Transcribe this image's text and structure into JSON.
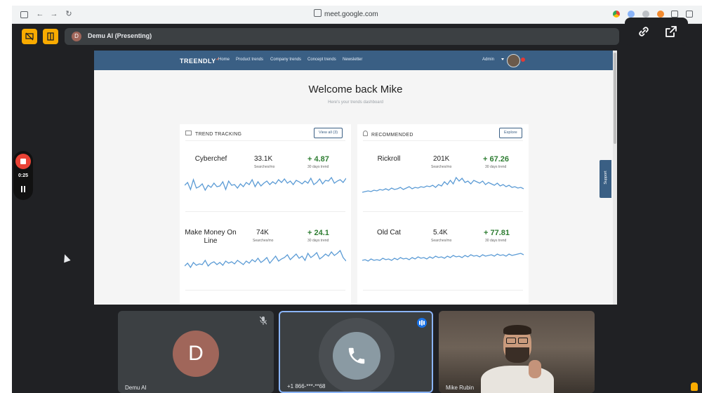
{
  "browser": {
    "url": "meet.google.com"
  },
  "meet": {
    "presenter_initial": "D",
    "presenting_label": "Demu AI (Presenting)",
    "recording_time": "0:25"
  },
  "app": {
    "logo": "TREENDLY",
    "nav": [
      "Home",
      "Product trends",
      "Company trends",
      "Concept trends",
      "Newsletter"
    ],
    "user_menu": "Admin",
    "welcome": "Welcome back Mike",
    "subtitle": "Here's your trends dashboard",
    "support": "Support",
    "cards": [
      {
        "title": "TREND TRACKING",
        "button": "View all (3)",
        "items": [
          {
            "name": "Cyberchef",
            "searches": "33.1K",
            "searches_label": "Searches/mo",
            "trend": "+ 4.87",
            "trend_label": "30 days trend",
            "spark": [
              18,
              14,
              24,
              10,
              22,
              20,
              16,
              25,
              18,
              21,
              15,
              20,
              19,
              13,
              24,
              12,
              18,
              17,
              22,
              16,
              20,
              14,
              17,
              10,
              20,
              13,
              19,
              15,
              12,
              17,
              13,
              16,
              10,
              14,
              9,
              15,
              12,
              17,
              11,
              13,
              16,
              12,
              15,
              8,
              17,
              14,
              9,
              16,
              11,
              12,
              7,
              15,
              12,
              10,
              14,
              8
            ]
          },
          {
            "name": "Make Money On Line",
            "searches": "74K",
            "searches_label": "Searches/mo",
            "trend": "+ 24.1",
            "trend_label": "30 days trend",
            "spark": [
              26,
              22,
              28,
              21,
              25,
              23,
              24,
              18,
              26,
              22,
              20,
              24,
              21,
              25,
              19,
              22,
              20,
              23,
              18,
              21,
              24,
              19,
              22,
              17,
              20,
              15,
              21,
              18,
              14,
              22,
              17,
              12,
              19,
              16,
              14,
              10,
              17,
              13,
              9,
              15,
              12,
              18,
              8,
              14,
              11,
              7,
              16,
              13,
              9,
              12,
              6,
              11,
              8,
              4,
              14,
              19
            ]
          }
        ]
      },
      {
        "title": "RECOMMENDED",
        "button": "Explore",
        "items": [
          {
            "name": "Rickroll",
            "searches": "201K",
            "searches_label": "Searches/mo",
            "trend": "+ 67.26",
            "trend_label": "30 days trend",
            "spark": [
              28,
              27,
              26,
              27,
              25,
              26,
              24,
              25,
              23,
              25,
              22,
              24,
              23,
              21,
              24,
              22,
              20,
              23,
              21,
              22,
              20,
              21,
              19,
              20,
              18,
              21,
              17,
              19,
              13,
              17,
              11,
              16,
              7,
              12,
              8,
              14,
              12,
              16,
              11,
              13,
              15,
              12,
              17,
              14,
              16,
              18,
              15,
              19,
              17,
              20,
              18,
              21,
              20,
              22,
              21,
              23
            ]
          },
          {
            "name": "Old Cat",
            "searches": "5.4K",
            "searches_label": "Searches/mo",
            "trend": "+ 77.81",
            "trend_label": "30 days trend",
            "spark": [
              20,
              19,
              21,
              18,
              20,
              19,
              20,
              17,
              19,
              18,
              20,
              17,
              19,
              16,
              18,
              17,
              19,
              16,
              18,
              15,
              17,
              16,
              18,
              15,
              17,
              14,
              16,
              15,
              17,
              14,
              16,
              13,
              15,
              14,
              16,
              13,
              15,
              12,
              14,
              13,
              15,
              12,
              14,
              13,
              12,
              14,
              11,
              13,
              12,
              14,
              11,
              13,
              12,
              11,
              10,
              12
            ]
          }
        ]
      }
    ]
  },
  "participants": [
    {
      "name": "Demu AI",
      "initial": "D"
    },
    {
      "name": "+1 866-***-**68"
    },
    {
      "name": "Mike Rubin"
    }
  ],
  "colors": {
    "accent": "#f9ab00",
    "nav": "#3a5f84",
    "trend_up": "#2e7d32",
    "spark": "#5b9bd5",
    "speaking": "#1a73e8"
  }
}
